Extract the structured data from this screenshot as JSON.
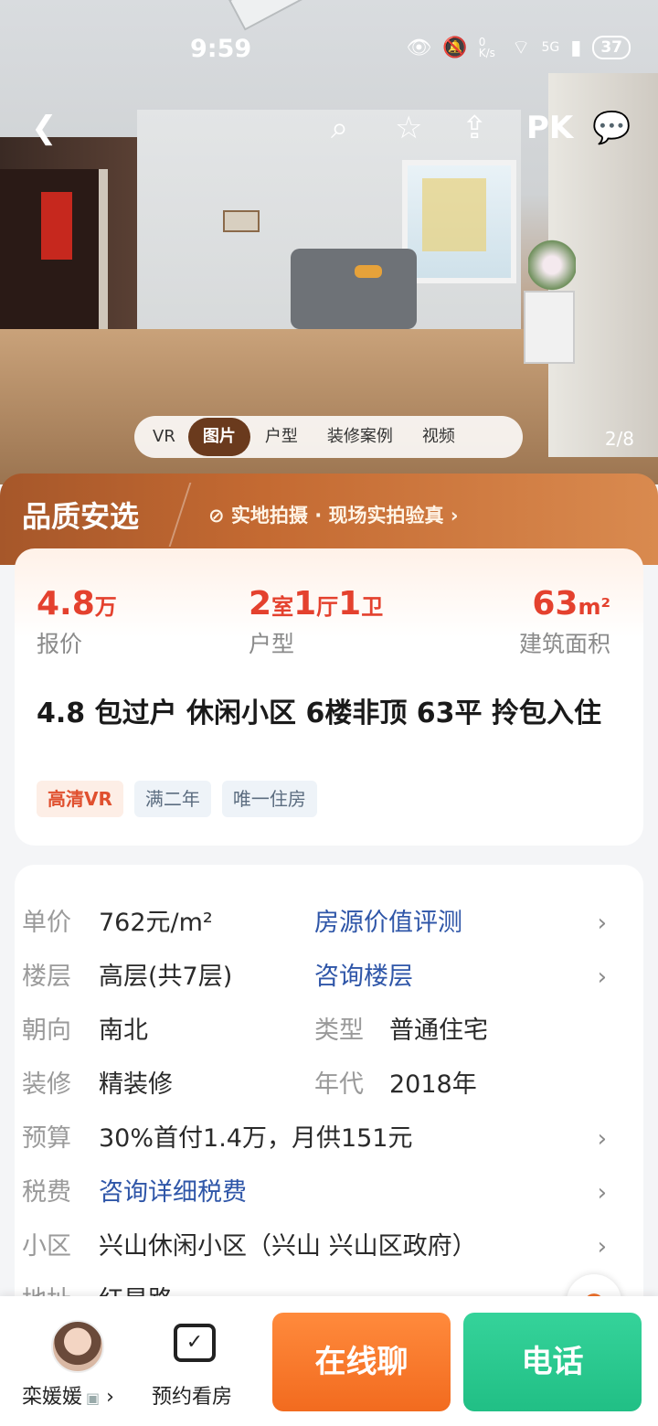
{
  "status_bar": {
    "time": "9:59",
    "net_speed": "0 K/s",
    "signal": "5G",
    "battery": "37"
  },
  "nav": {
    "back_icon": "chevron-left-icon",
    "pk_label": "PK"
  },
  "gallery": {
    "tabs": [
      {
        "label": "VR"
      },
      {
        "label": "图片"
      },
      {
        "label": "户型"
      },
      {
        "label": "装修案例"
      },
      {
        "label": "视频"
      }
    ],
    "active_tab": "图片",
    "counter": "2/8"
  },
  "quality": {
    "label": "品质安选",
    "verify_text": "实地拍摄 · 现场实拍验真"
  },
  "summary": {
    "price_value": "4.8",
    "price_unit": "万",
    "price_label": "报价",
    "layout_room": "2",
    "layout_room_unit": "室",
    "layout_hall": "1",
    "layout_hall_unit": "厅",
    "layout_bath": "1",
    "layout_bath_unit": "卫",
    "layout_label": "户型",
    "area_value": "63",
    "area_unit": "m²",
    "area_label": "建筑面积",
    "title": "4.8 包过户 休闲小区 6楼非顶 63平 拎包入住",
    "tags": [
      {
        "text": "高清VR"
      },
      {
        "text": "满二年"
      },
      {
        "text": "唯一住房"
      }
    ]
  },
  "details": {
    "unit_price_key": "单价",
    "unit_price_value": "762元/m²",
    "valuation_link": "房源价值评测",
    "floor_key": "楼层",
    "floor_value": "高层(共7层)",
    "floor_link": "咨询楼层",
    "orientation_key": "朝向",
    "orientation_value": "南北",
    "type_key": "类型",
    "type_value": "普通住宅",
    "decor_key": "装修",
    "decor_value": "精装修",
    "year_key": "年代",
    "year_value": "2018年",
    "budget_key": "预算",
    "budget_value": "30%首付1.4万，月供151元",
    "tax_key": "税费",
    "tax_link": "咨询详细税费",
    "community_key": "小区",
    "community_value": "兴山休闲小区（兴山 兴山区政府）",
    "address_key": "地址",
    "address_value": "红星路"
  },
  "bottom_bar": {
    "agent_name": "栾媛媛",
    "appointment_label": "预约看房",
    "chat_button": "在线聊",
    "call_button": "电话"
  }
}
